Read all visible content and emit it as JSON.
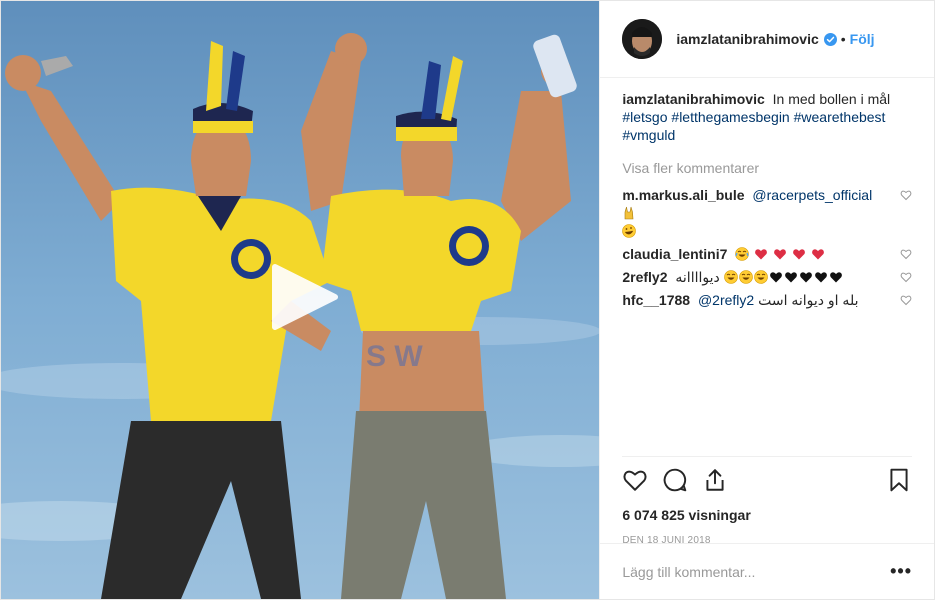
{
  "author": {
    "username": "iamzlatanibrahimovic",
    "follow_label": "Följ",
    "separator": "•"
  },
  "caption": {
    "username": "iamzlatanibrahimovic",
    "text": "In med bollen i mål",
    "hashtags": [
      "#letsgo",
      "#letthegamesbegin",
      "#wearethebest",
      "#vmguld"
    ]
  },
  "load_more_label": "Visa fler kommentarer",
  "comments": [
    {
      "username": "m.markus.ali_bule",
      "mention": "@racerpets_official",
      "text": "",
      "emoji": [
        "horns-emoji",
        "rofl-emoji"
      ]
    },
    {
      "username": "claudia_lentini7",
      "mention": "",
      "text": "",
      "emoji": [
        "joy-emoji",
        "two-hearts-emoji",
        "two-hearts-emoji",
        "two-hearts-emoji",
        "two-hearts-emoji"
      ]
    },
    {
      "username": "2refly2",
      "mention": "",
      "text": "دیواااانه",
      "emoji": [
        "joy-emoji",
        "joy-emoji",
        "joy-emoji",
        "black-heart-emoji",
        "black-heart-emoji",
        "black-heart-emoji",
        "black-heart-emoji",
        "black-heart-emoji"
      ]
    },
    {
      "username": "hfc__1788",
      "mention": "@2refly2",
      "text": "بله او دیوانه است",
      "emoji": []
    }
  ],
  "stats": {
    "views": "6 074 825 visningar",
    "date": "DEN 18 JUNI 2018"
  },
  "add_comment": {
    "placeholder": "Lägg till kommentar...",
    "more_label": "•••"
  },
  "colors": {
    "link": "#003569",
    "follow": "#3897f0",
    "muted": "#999999",
    "verified": "#3897f0",
    "shirt_yellow": "#f3d72a",
    "sky": "#6d9ec6"
  }
}
